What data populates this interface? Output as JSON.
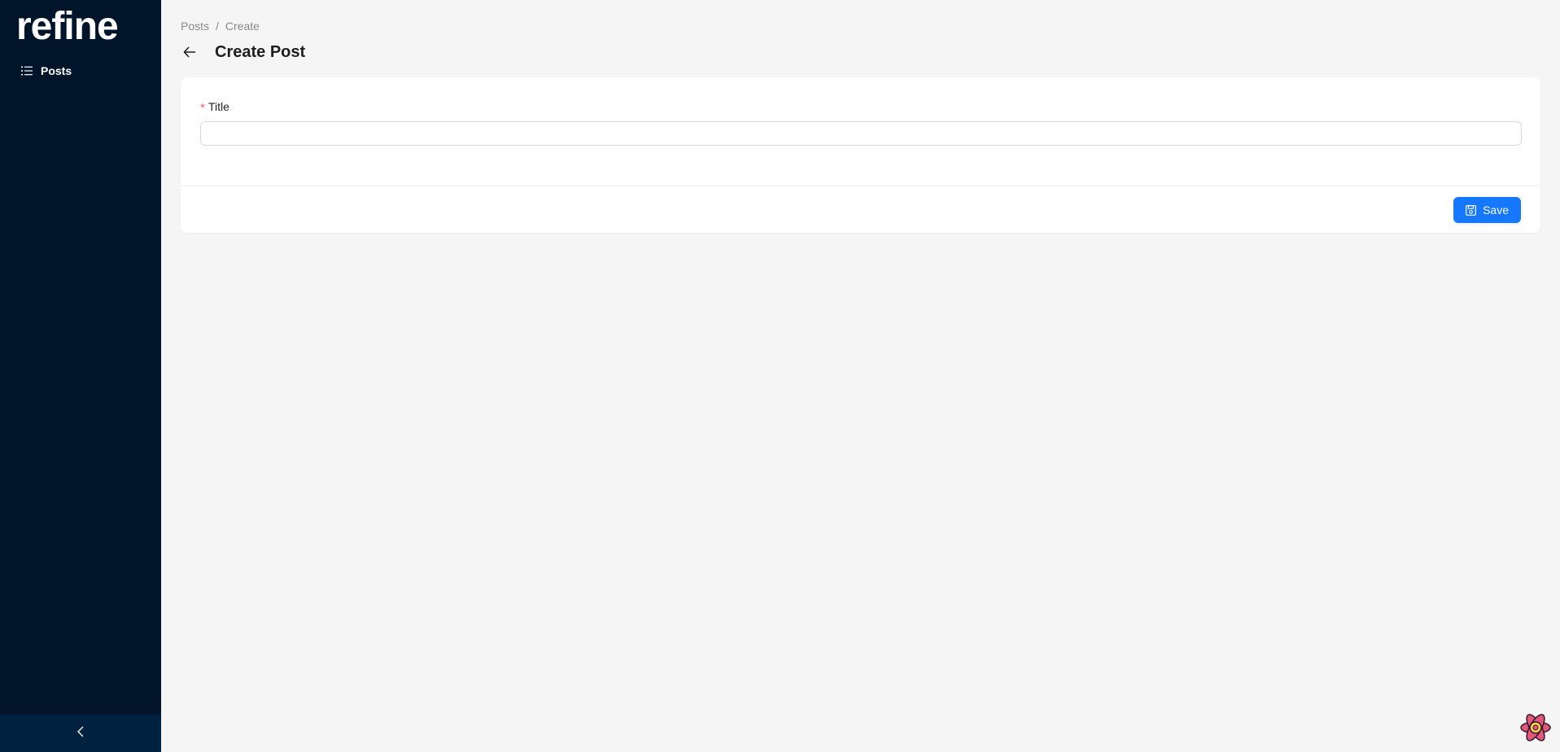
{
  "sidebar": {
    "logo_text": "refine",
    "items": [
      {
        "label": "Posts",
        "icon": "list-icon"
      }
    ],
    "collapse_icon": "chevron-left-icon"
  },
  "breadcrumb": {
    "items": [
      "Posts",
      "Create"
    ],
    "separator": "/"
  },
  "header": {
    "back_icon": "arrow-left-icon",
    "title": "Create Post"
  },
  "form": {
    "title_field": {
      "required_mark": "*",
      "label": "Title",
      "value": "",
      "placeholder": ""
    },
    "save_label": "Save",
    "save_icon": "save-icon"
  },
  "colors": {
    "sidebar_bg": "#001529",
    "collapse_bg": "#002140",
    "primary": "#1677ff",
    "page_bg": "#f5f5f5",
    "required": "#ff4d4f"
  },
  "devtools": {
    "icon": "refine-devtools-icon"
  }
}
